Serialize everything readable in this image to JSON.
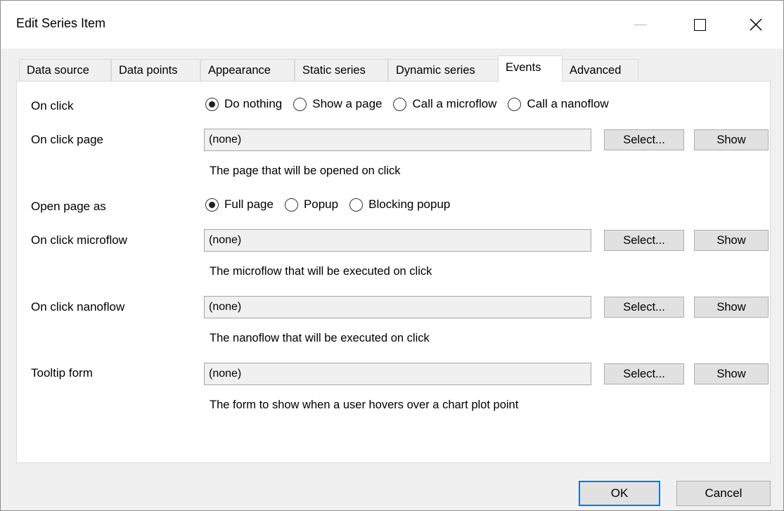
{
  "window": {
    "title": "Edit Series Item",
    "controls": {
      "minimize": "minimize-icon",
      "maximize": "maximize-icon",
      "close": "close-icon"
    }
  },
  "tabs": [
    {
      "label": "Data source",
      "active": false
    },
    {
      "label": "Data points",
      "active": false
    },
    {
      "label": "Appearance",
      "active": false
    },
    {
      "label": "Static series",
      "active": false
    },
    {
      "label": "Dynamic series",
      "active": false
    },
    {
      "label": "Events",
      "active": true
    },
    {
      "label": "Advanced",
      "active": false
    }
  ],
  "events": {
    "on_click": {
      "label": "On click",
      "options": [
        {
          "label": "Do nothing",
          "selected": true
        },
        {
          "label": "Show a page",
          "selected": false
        },
        {
          "label": "Call a microflow",
          "selected": false
        },
        {
          "label": "Call a nanoflow",
          "selected": false
        }
      ]
    },
    "on_click_page": {
      "label": "On click page",
      "value": "(none)",
      "select_label": "Select...",
      "show_label": "Show",
      "hint": "The page that will be opened on click"
    },
    "open_page_as": {
      "label": "Open page as",
      "options": [
        {
          "label": "Full page",
          "selected": true
        },
        {
          "label": "Popup",
          "selected": false
        },
        {
          "label": "Blocking popup",
          "selected": false
        }
      ]
    },
    "on_click_microflow": {
      "label": "On click microflow",
      "value": "(none)",
      "select_label": "Select...",
      "show_label": "Show",
      "hint": "The microflow that will be executed on click"
    },
    "on_click_nanoflow": {
      "label": "On click nanoflow",
      "value": "(none)",
      "select_label": "Select...",
      "show_label": "Show",
      "hint": "The nanoflow that will be executed on click"
    },
    "tooltip_form": {
      "label": "Tooltip form",
      "value": "(none)",
      "select_label": "Select...",
      "show_label": "Show",
      "hint": "The form to show when a user hovers over a chart plot point"
    }
  },
  "footer": {
    "ok_label": "OK",
    "cancel_label": "Cancel"
  }
}
